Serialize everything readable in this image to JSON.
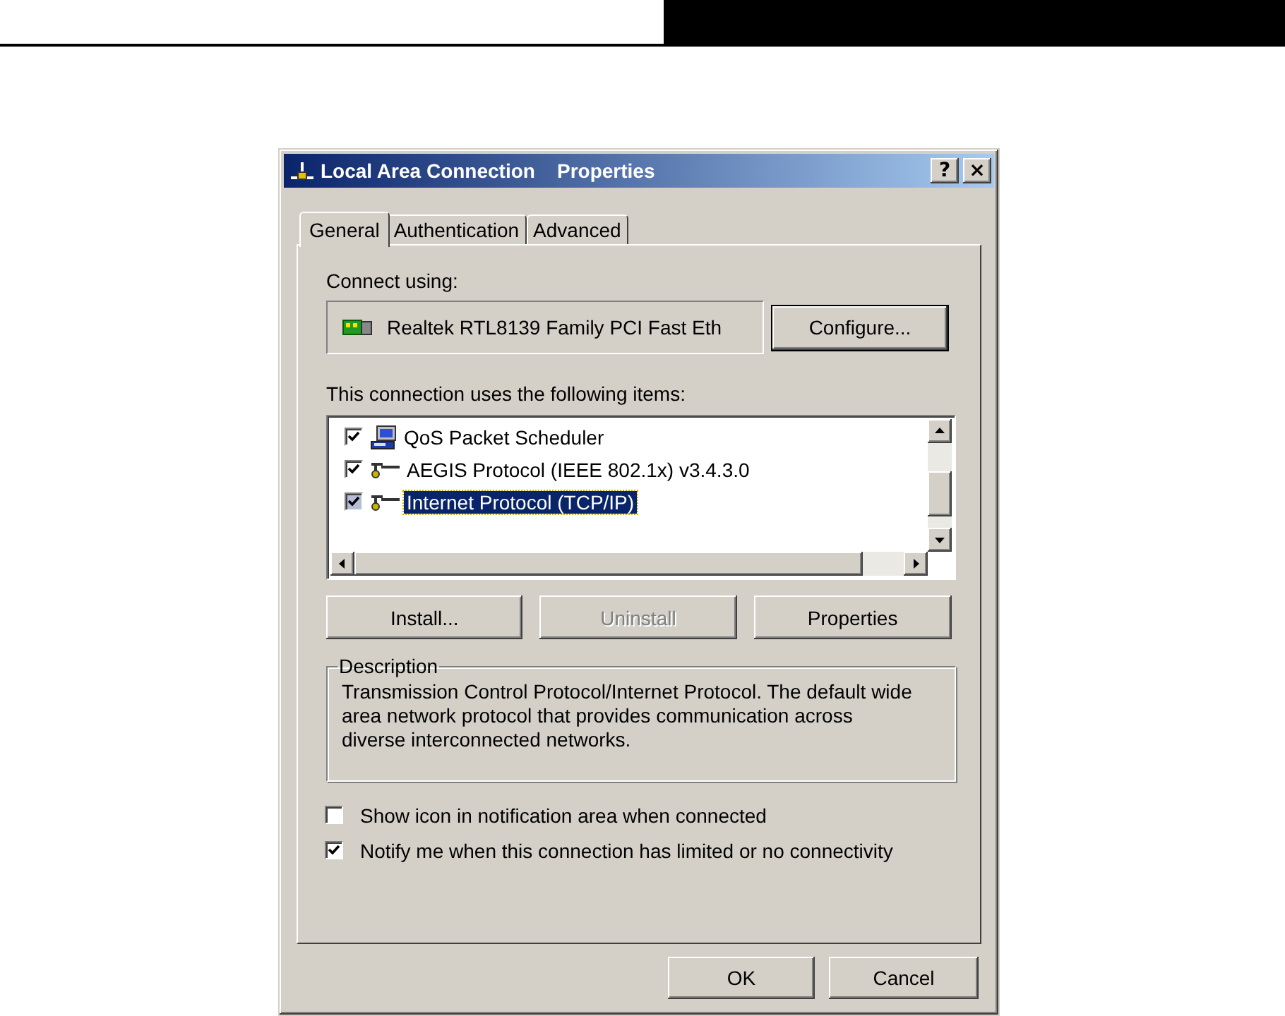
{
  "window": {
    "title": "Local Area Connection    Properties",
    "help_button": "?",
    "close_button": "×"
  },
  "tabs": [
    {
      "label": "General",
      "selected": true
    },
    {
      "label": "Authentication",
      "selected": false
    },
    {
      "label": "Advanced",
      "selected": false
    }
  ],
  "connect_using": {
    "label": "Connect using:",
    "adapter": "Realtek RTL8139 Family PCI Fast Eth",
    "configure_button": "Configure..."
  },
  "items": {
    "label": "This connection uses the following items:",
    "rows": [
      {
        "kind": "scheduler",
        "label": "QoS Packet Scheduler",
        "checked": true,
        "selected": false
      },
      {
        "kind": "protocol",
        "label": "AEGIS Protocol (IEEE 802.1x) v3.4.3.0",
        "checked": true,
        "selected": false
      },
      {
        "kind": "protocol",
        "label": "Internet Protocol (TCP/IP)",
        "checked": true,
        "selected": true
      }
    ]
  },
  "item_buttons": [
    {
      "label": "Install...",
      "disabled": false
    },
    {
      "label": "Uninstall",
      "disabled": true
    },
    {
      "label": "Properties",
      "disabled": false
    }
  ],
  "description": {
    "title": "Description",
    "text": "Transmission Control Protocol/Internet Protocol. The default wide area network protocol that provides communication across diverse interconnected networks."
  },
  "options": [
    {
      "label": "Show icon in notification area when connected",
      "checked": false
    },
    {
      "label": "Notify me when this connection has limited or no connectivity",
      "checked": true
    }
  ],
  "footer_buttons": [
    {
      "label": "OK"
    },
    {
      "label": "Cancel"
    }
  ]
}
